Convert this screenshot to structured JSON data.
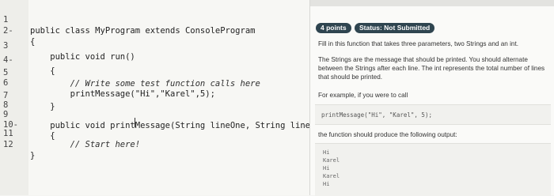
{
  "editor": {
    "lines": [
      {
        "n": "1",
        "code": "public class MyProgram extends ConsoleProgram"
      },
      {
        "n": "2-",
        "code": "{"
      },
      {
        "n": "3",
        "code": "    public void run()"
      },
      {
        "n": "4-",
        "code": "    {"
      },
      {
        "n": "5",
        "code": "        // Write some test function calls here"
      },
      {
        "n": "6",
        "code": "        printMessage(\"Hi\",\"Karel\",5);"
      },
      {
        "n": "7",
        "code": "    }"
      },
      {
        "n": "8",
        "code": ""
      },
      {
        "n": "9",
        "code": "    public void printMessage(String lineOne, String lineTwo, in"
      },
      {
        "n": "10-",
        "code": "    {"
      },
      {
        "n": "11",
        "code": "        // Start here!"
      },
      {
        "n": "12",
        "code": "}"
      }
    ]
  },
  "panel": {
    "points_badge": "4 points",
    "status_badge": "Status: Not Submitted",
    "instruction": "Fill in this function that takes three parameters, two Strings and an int.",
    "description": "The Strings are the message that should be printed. You should alternate between the Strings after each line. The int represents the total number of lines that should be printed.",
    "example_intro": "For example, if you were to call",
    "example_call": "printMessage(\"Hi\", \"Karel\", 5);",
    "output_intro": "the function should produce the following output:",
    "output_lines": [
      "Hi",
      "Karel",
      "Hi",
      "Karel",
      "Hi"
    ]
  }
}
